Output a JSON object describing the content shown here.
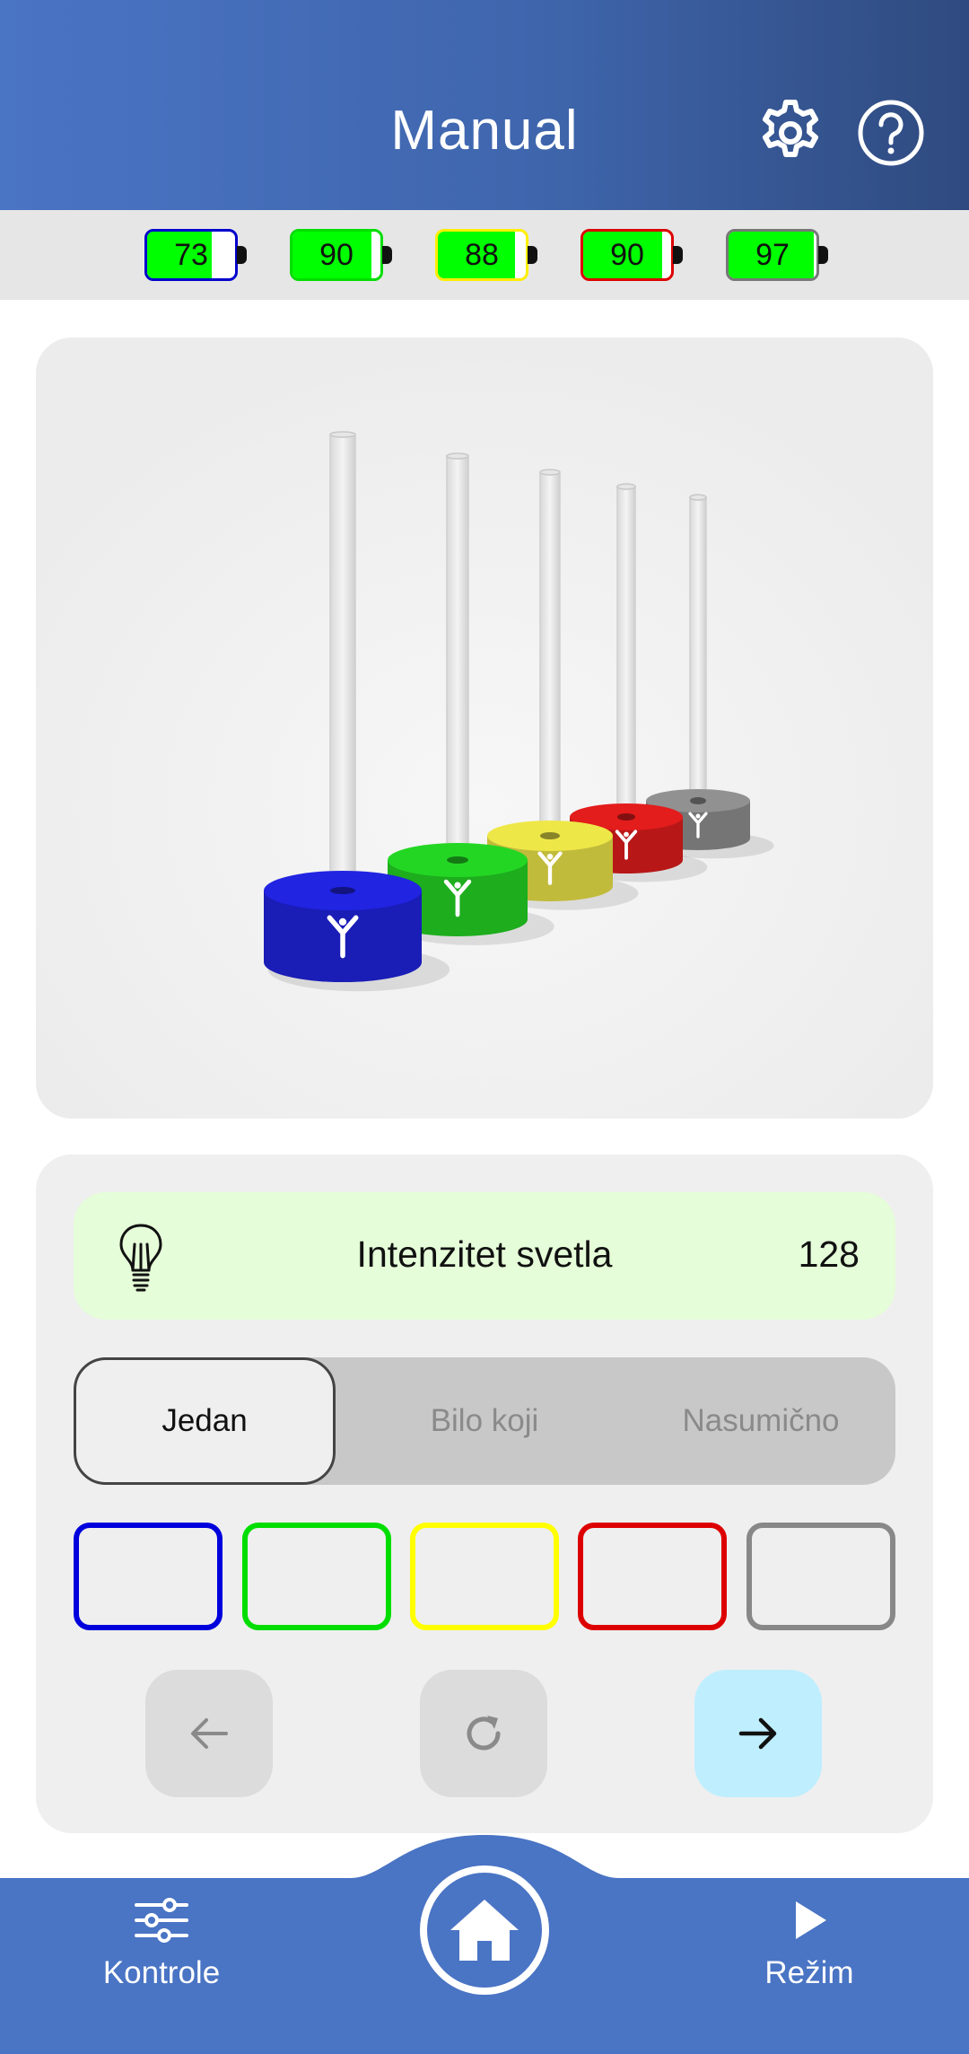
{
  "header": {
    "title": "Manual",
    "settings_icon": "gear-icon",
    "help_icon": "question-circle-icon",
    "colors": {
      "gradient_start": "#4a74c4",
      "gradient_end": "#2f4a7f"
    }
  },
  "batteries": [
    {
      "value": "73",
      "level": 0.73,
      "border": "#0000cc"
    },
    {
      "value": "90",
      "level": 0.9,
      "border": "#00dd00"
    },
    {
      "value": "88",
      "level": 0.88,
      "border": "#ffee00"
    },
    {
      "value": "90",
      "level": 0.9,
      "border": "#dd0000"
    },
    {
      "value": "97",
      "level": 0.97,
      "border": "#777777"
    }
  ],
  "scene": {
    "pegs": [
      {
        "color": "#1f22d6",
        "icon": "tree-symbol-icon"
      },
      {
        "color": "#22cc22",
        "icon": "tree-symbol-icon"
      },
      {
        "color": "#e3dc45",
        "icon": "tree-symbol-icon"
      },
      {
        "color": "#d81b1b",
        "icon": "tree-symbol-icon"
      },
      {
        "color": "#8a8a8a",
        "icon": "tree-symbol-icon"
      }
    ]
  },
  "controls": {
    "intensity": {
      "icon": "lightbulb-icon",
      "label": "Intenzitet svetla",
      "value": "128"
    },
    "modes": [
      {
        "label": "Jedan",
        "active": true
      },
      {
        "label": "Bilo koji",
        "active": false
      },
      {
        "label": "Nasumično",
        "active": false
      }
    ],
    "swatches": [
      {
        "color": "#0000dd"
      },
      {
        "color": "#00dd00"
      },
      {
        "color": "#ffff00"
      },
      {
        "color": "#dd0000"
      },
      {
        "color": "#888888"
      }
    ],
    "nav": {
      "prev_icon": "arrow-left-icon",
      "reset_icon": "refresh-icon",
      "next_icon": "arrow-right-icon"
    }
  },
  "bottom_nav": {
    "left": {
      "label": "Kontrole",
      "icon": "sliders-icon"
    },
    "center": {
      "icon": "home-icon"
    },
    "right": {
      "label": "Režim",
      "icon": "play-icon"
    },
    "color": "#4a74c4"
  }
}
